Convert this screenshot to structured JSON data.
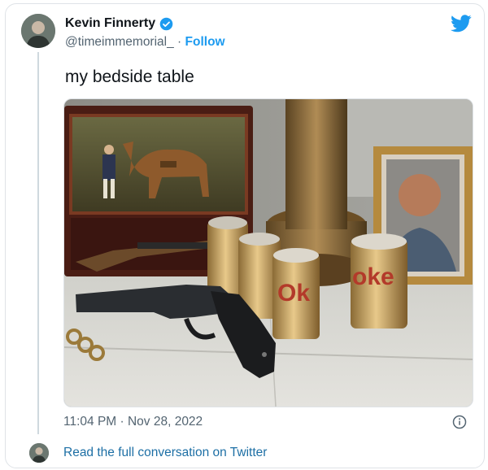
{
  "tweet": {
    "author_name": "Kevin Finnerty",
    "handle": "@timeimmemorial_",
    "separator": " · ",
    "follow_label": "Follow",
    "text": "my bedside table",
    "timestamp": "11:04 PM · Nov 28, 2022",
    "can_label_left": "Ok",
    "can_label_right": "oke"
  },
  "footer": {
    "read_link": "Read the full conversation on Twitter"
  },
  "colors": {
    "twitter_blue": "#1d9bf0",
    "link": "#1d6fa5",
    "secondary_text": "#536471"
  },
  "icons": [
    "verified-badge-icon",
    "twitter-bird-icon",
    "info-icon"
  ]
}
